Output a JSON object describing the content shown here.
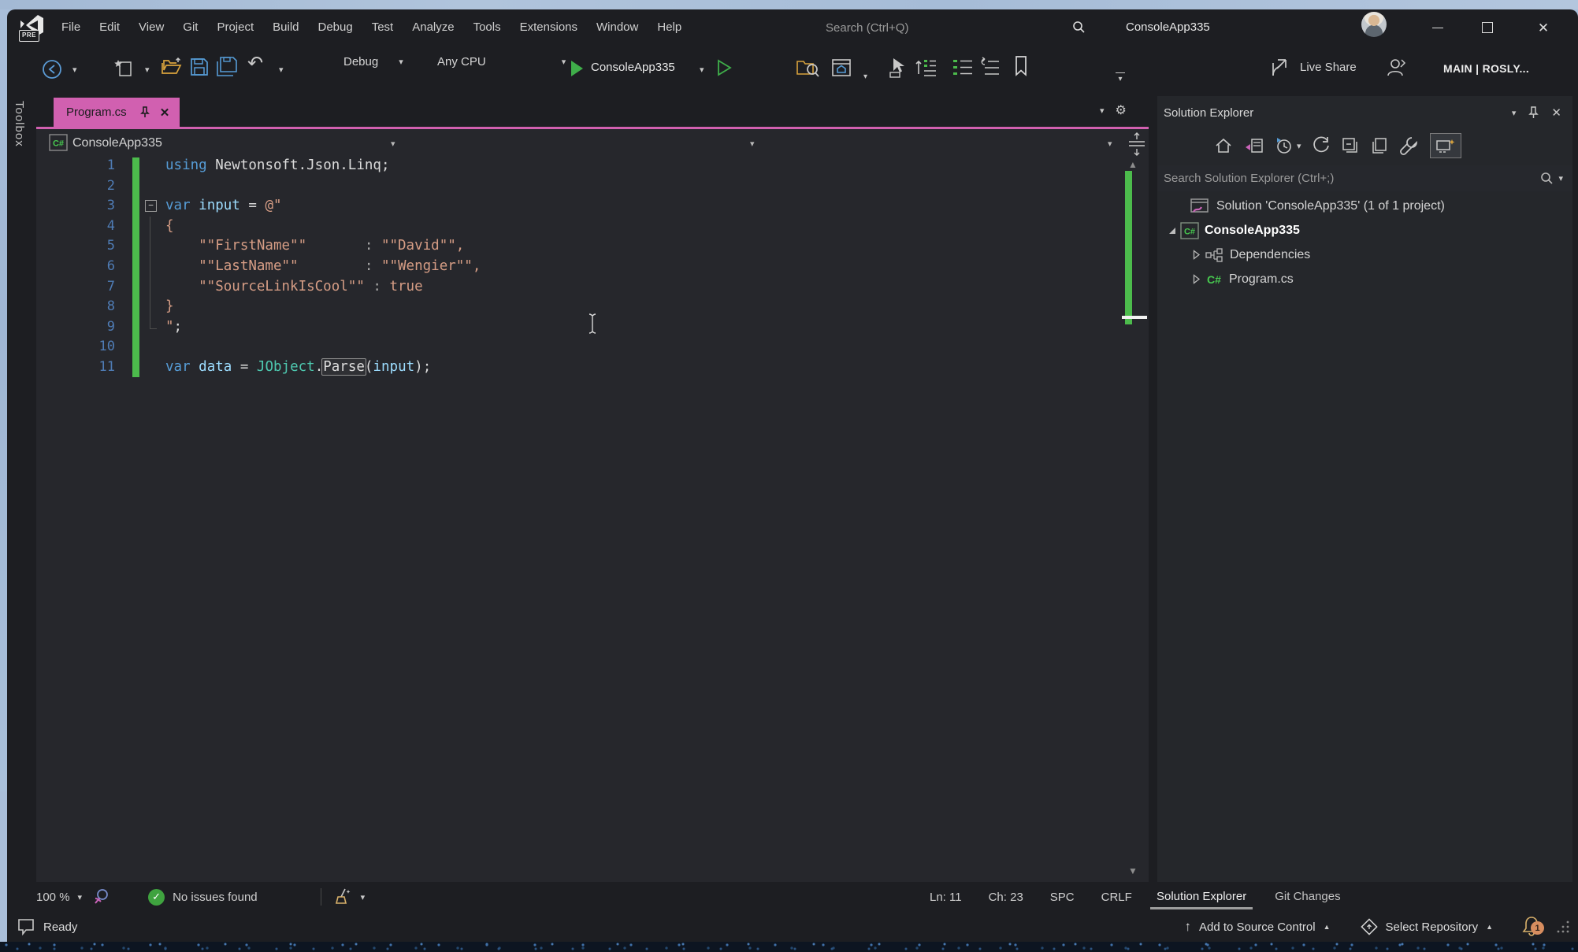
{
  "window": {
    "title": "ConsoleApp335",
    "logo_badge": "PRE"
  },
  "menu": {
    "items": [
      "File",
      "Edit",
      "View",
      "Git",
      "Project",
      "Build",
      "Debug",
      "Test",
      "Analyze",
      "Tools",
      "Extensions",
      "Window",
      "Help"
    ],
    "search_placeholder": "Search (Ctrl+Q)"
  },
  "toolbar": {
    "configuration": "Debug",
    "platform": "Any CPU",
    "startup_project": "ConsoleApp335",
    "live_share": "Live Share",
    "branch": "MAIN | ROSLY..."
  },
  "toolbox": {
    "label": "Toolbox"
  },
  "editor": {
    "tab": "Program.cs",
    "breadcrumb_project": "ConsoleApp335",
    "syntax_colors": {
      "kw": "#569cd6",
      "id": "#9cdcfe",
      "cls": "#4ec9b0",
      "str": "#d69d85",
      "spn": "#a8a8a8",
      "pln": "#dcdcdc",
      "box": "#dcdcdc"
    },
    "accent_pink": "#d160b0",
    "change_bar_color": "#4cbb4c",
    "lines": [
      {
        "n": 1,
        "tokens": [
          [
            "kw",
            "using"
          ],
          [
            "pln",
            " Newtonsoft.Json.Linq;"
          ]
        ]
      },
      {
        "n": 2,
        "tokens": []
      },
      {
        "n": 3,
        "fold": "start",
        "tokens": [
          [
            "kw",
            "var"
          ],
          [
            "pln",
            " "
          ],
          [
            "id",
            "input"
          ],
          [
            "pln",
            " = "
          ],
          [
            "str",
            "@\""
          ]
        ]
      },
      {
        "n": 4,
        "fold": "mid",
        "tokens": [
          [
            "str",
            "{"
          ]
        ]
      },
      {
        "n": 5,
        "fold": "mid",
        "tokens": [
          [
            "str",
            "    \"\"FirstName\"\"       "
          ],
          [
            "spn",
            ": "
          ],
          [
            "str",
            "\"\"David\"\","
          ]
        ]
      },
      {
        "n": 6,
        "fold": "mid",
        "tokens": [
          [
            "str",
            "    \"\"LastName\"\"        "
          ],
          [
            "spn",
            ": "
          ],
          [
            "str",
            "\"\"Wengier\"\","
          ]
        ]
      },
      {
        "n": 7,
        "fold": "mid",
        "tokens": [
          [
            "str",
            "    \"\"SourceLinkIsCool\"\" "
          ],
          [
            "spn",
            ": "
          ],
          [
            "str",
            "true"
          ]
        ]
      },
      {
        "n": 8,
        "fold": "mid",
        "tokens": [
          [
            "str",
            "}"
          ]
        ]
      },
      {
        "n": 9,
        "fold": "end",
        "tokens": [
          [
            "str",
            "\""
          ],
          [
            "pln",
            ";"
          ]
        ]
      },
      {
        "n": 10,
        "tokens": []
      },
      {
        "n": 11,
        "tokens": [
          [
            "kw",
            "var"
          ],
          [
            "pln",
            " "
          ],
          [
            "id",
            "data"
          ],
          [
            "pln",
            " = "
          ],
          [
            "cls",
            "JObject"
          ],
          [
            "pln",
            "."
          ],
          [
            "box",
            "Parse"
          ],
          [
            "pln",
            "("
          ],
          [
            "id",
            "input"
          ],
          [
            "pln",
            ");"
          ]
        ]
      }
    ]
  },
  "solution_explorer": {
    "title": "Solution Explorer",
    "search_placeholder": "Search Solution Explorer (Ctrl+;)",
    "tree": [
      {
        "icon": "solution",
        "label": "Solution 'ConsoleApp335' (1 of 1 project)",
        "indent": 0,
        "expander": "none",
        "bold": false
      },
      {
        "icon": "csproj",
        "label": "ConsoleApp335",
        "indent": 0,
        "expander": "expanded",
        "bold": true
      },
      {
        "icon": "dependencies",
        "label": "Dependencies",
        "indent": 1,
        "expander": "collapsed",
        "bold": false
      },
      {
        "icon": "csfile",
        "label": "Program.cs",
        "indent": 1,
        "expander": "collapsed",
        "bold": false
      }
    ]
  },
  "status": {
    "zoom": "100 %",
    "issues": "No issues found",
    "line": "Ln: 11",
    "column": "Ch: 23",
    "spaces": "SPC",
    "line_ending": "CRLF",
    "panel_tabs": [
      {
        "label": "Solution Explorer",
        "active": true
      },
      {
        "label": "Git Changes",
        "active": false
      }
    ],
    "ready": "Ready",
    "add_to_source_control": "Add to Source Control",
    "select_repository": "Select Repository",
    "notifications": "1"
  }
}
